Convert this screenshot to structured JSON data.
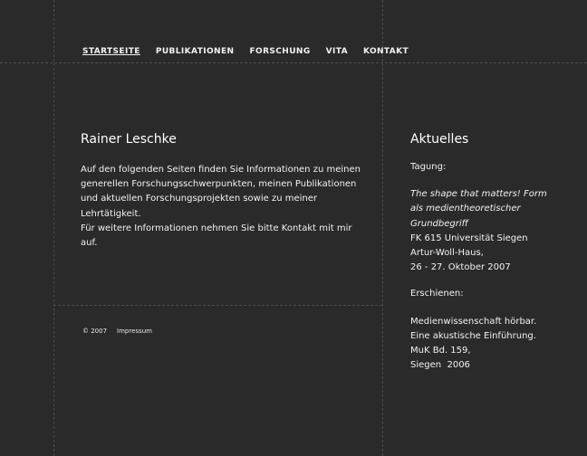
{
  "nav": {
    "items": [
      "STARTSEITE",
      "PUBLIKATIONEN",
      "FORSCHUNG",
      "VITA",
      "KONTAKT"
    ]
  },
  "main": {
    "title": "Rainer Leschke",
    "paragraph_1": "Auf den folgenden Seiten finden Sie Informationen zu meinen generellen Forschungsschwerpunkten, meinen Publikationen und aktuellen Forschungsprojekten sowie zu meiner Lehrtätigkeit.",
    "paragraph_2": "Für weitere Informationen nehmen Sie bitte Kontakt mit mir auf."
  },
  "footer": {
    "copyright": "© 2007",
    "impressum": "Impressum"
  },
  "sidebar": {
    "title": "Aktuelles",
    "tagung_label": "Tagung:",
    "tagung_title_1": "The shape that matters! Form",
    "tagung_title_2": "als medientheoretischer",
    "tagung_title_3": "Grundbegriff",
    "tagung_line_1": "FK 615 Universität Siegen",
    "tagung_line_2": "Artur-Woll-Haus,",
    "tagung_line_3": "26 - 27. Oktober 2007",
    "erschienen_label": "Erschienen:",
    "pub_line_1": "Medienwissenschaft hörbar.",
    "pub_line_2": "Eine akustische Einführung.",
    "pub_line_3": "MuK Bd. 159,",
    "pub_line_4": "Siegen  2006"
  }
}
